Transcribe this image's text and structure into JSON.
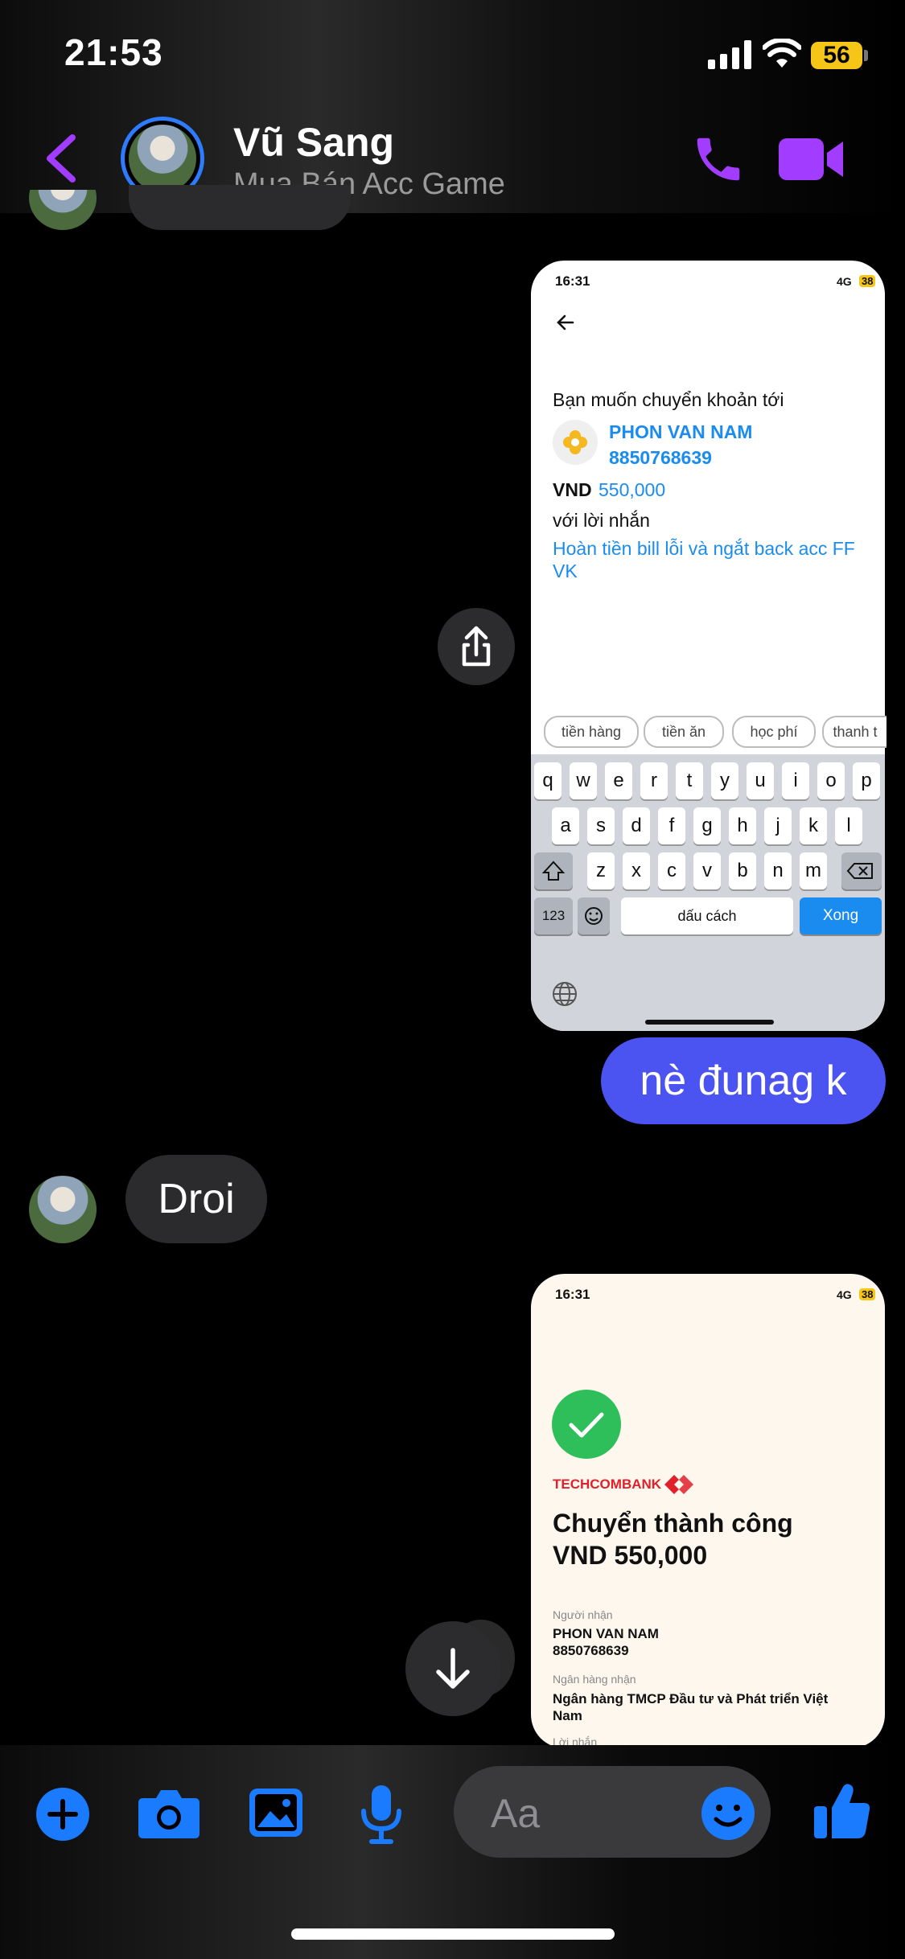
{
  "status_bar": {
    "time": "21:53",
    "battery": "56"
  },
  "header": {
    "name": "Vũ Sang",
    "subtitle": "Mua Bán Acc Game"
  },
  "screenshot1": {
    "time": "16:31",
    "network": "4G",
    "battery": "38",
    "prompt": "Bạn muốn chuyển khoản tới",
    "recipient_name": "PHON VAN NAM",
    "recipient_account": "8850768639",
    "currency": "VND",
    "amount": "550,000",
    "message_label": "với lời nhắn",
    "message_text": "Hoàn tiền bill lỗi và ngắt back acc FF VK",
    "chips": [
      "tiền hàng",
      "tiền ăn",
      "học phí",
      "thanh t"
    ],
    "keyboard": {
      "row1": [
        "q",
        "w",
        "e",
        "r",
        "t",
        "y",
        "u",
        "i",
        "o",
        "p"
      ],
      "row2": [
        "a",
        "s",
        "d",
        "f",
        "g",
        "h",
        "j",
        "k",
        "l"
      ],
      "row3": [
        "z",
        "x",
        "c",
        "v",
        "b",
        "n",
        "m"
      ],
      "num_key": "123",
      "space_key": "dấu cách",
      "done_key": "Xong"
    }
  },
  "messages": {
    "sent_text": "nè đunag k",
    "received_text": "Droi"
  },
  "screenshot2": {
    "time": "16:31",
    "network": "4G",
    "battery": "38",
    "bank": "TECHCOMBANK",
    "status_title": "Chuyển thành công",
    "amount_line": "VND 550,000",
    "recipient_label": "Người nhận",
    "recipient_name": "PHON VAN NAM",
    "recipient_account": "8850768639",
    "bank_label": "Ngân hàng nhận",
    "bank_name": "Ngân hàng TMCP Đầu tư và Phát triển Việt Nam",
    "note_label": "Lời nhắn"
  },
  "composer": {
    "placeholder": "Aa"
  },
  "colors": {
    "accent_purple": "#a23cff",
    "accent_blue": "#1b7bff",
    "sent_bubble": "#4b53f0",
    "received_bubble": "#2b2b2d"
  }
}
